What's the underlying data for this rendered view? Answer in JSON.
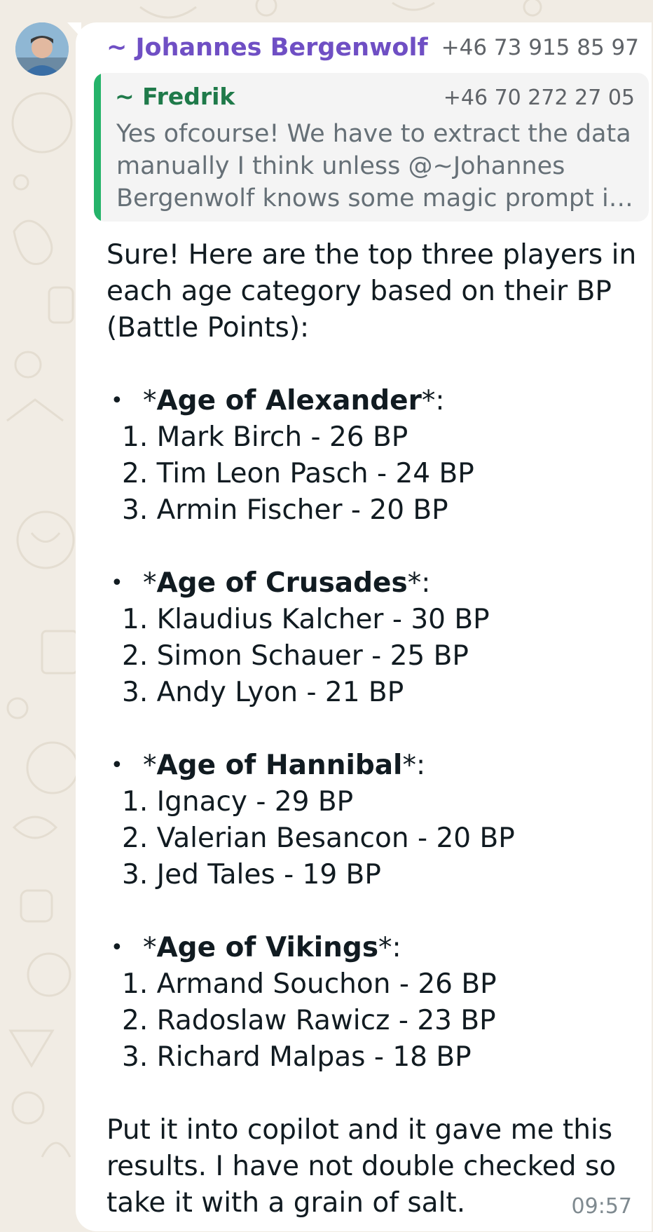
{
  "message": {
    "sender_name": "~ Johannes Bergenwolf",
    "sender_phone": "+46 73 915 85 97",
    "quoted": {
      "name": "~ Fredrik",
      "phone": "+46 70 272 27 05",
      "text": "Yes ofcourse! We have to extract the data manually I think unless @~Johannes Bergenwolf knows some magic prompt i…"
    },
    "intro": "Sure! Here are the top three players in each age category based on their BP (Battle Points):",
    "bullet_symbol": "•",
    "categories": [
      {
        "open_marker": "*",
        "name": "Age of Alexander",
        "close_marker": "*:",
        "players": [
          "1. Mark Birch - 26 BP",
          "2. Tim Leon Pasch - 24 BP",
          "3. Armin Fischer - 20 BP"
        ]
      },
      {
        "open_marker": "*",
        "name": "Age of Crusades",
        "close_marker": "*:",
        "players": [
          "1. Klaudius Kalcher - 30 BP",
          "2. Simon Schauer - 25 BP",
          "3. Andy Lyon - 21 BP"
        ]
      },
      {
        "open_marker": "*",
        "name": "Age of Hannibal",
        "close_marker": "*:",
        "players": [
          "1. Ignacy - 29 BP",
          "2. Valerian Besancon - 20 BP",
          "3. Jed Tales - 19 BP"
        ]
      },
      {
        "open_marker": "*",
        "name": "Age of Vikings",
        "close_marker": "*:",
        "players": [
          "1. Armand Souchon - 26 BP",
          "2. Radoslaw Rawicz - 23 BP",
          "3. Richard Malpas - 18 BP"
        ]
      }
    ],
    "closing": "Put it into copilot and it gave me this results. I have not double checked so take it with a grain of salt.",
    "time": "09:57"
  },
  "colors": {
    "sender_name": "#6f4fc4",
    "quote_bar": "#25b36a",
    "quote_name": "#1f7a4a",
    "wallpaper": "#f1ece4"
  },
  "icons": {
    "avatar": "user-photo"
  }
}
